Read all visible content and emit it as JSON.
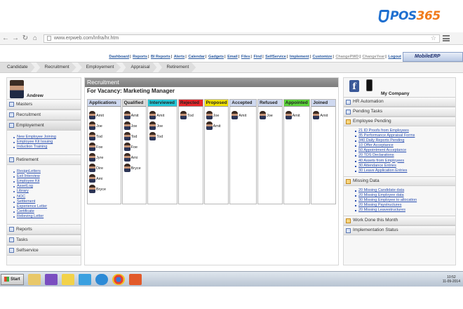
{
  "brand": {
    "prefix": "POS",
    "number": "365"
  },
  "browser": {
    "url": "www.erpweb.com/Infra/hr.htm",
    "back_icon": "back-arrow-icon",
    "forward_icon": "forward-arrow-icon",
    "reload_icon": "reload-icon",
    "home_icon": "home-icon"
  },
  "top_menu": {
    "items": [
      "Dashboard",
      "Reports",
      "BI Reports",
      "Alerts",
      "Calendar",
      "Gadgets",
      "Email",
      "Files",
      "Find",
      "SelfService",
      "Implement",
      "Customize"
    ],
    "dim_items": [
      "ChangePWD",
      "ChangeYear"
    ],
    "logout": "Logout",
    "mobile_erp": "MobileERP"
  },
  "tabs": [
    "Candidate",
    "Recruitment",
    "Employement",
    "Appraisal",
    "Retirement"
  ],
  "user": {
    "name": "Andrew"
  },
  "left_sections": {
    "masters": "Masters",
    "recruitment": "Recruitment",
    "employement": "Employement",
    "employement_links": [
      "New Employee Joining",
      "Employee Kit Issuing",
      "Induction Training"
    ],
    "retirement": "Retirement",
    "retirement_links": [
      "ResignLetters",
      "Exit Interview",
      "Employee Kit",
      "AssetLog",
      "Library",
      "NOC",
      "Settlement",
      "Experience Letter",
      "Certificate",
      "Relieving Letter"
    ],
    "reports": "Reports",
    "tasks": "Tasks",
    "selfservice": "Selfservice"
  },
  "main": {
    "header": "Recruitment",
    "vacancy": "For Vacancy: Marketing Manager",
    "columns": [
      {
        "title": "Applications",
        "color": "#cfd9f0",
        "people": [
          "Amit",
          "Joe",
          "Tod",
          "Foe",
          "Jyre",
          "Dire",
          "Ami",
          "Bryce"
        ]
      },
      {
        "title": "Qualified",
        "color": "#dadada",
        "people": [
          "Amit",
          "Joe",
          "Tod",
          "Foe",
          "Ami",
          "Bryce"
        ]
      },
      {
        "title": "Interviewed",
        "color": "#24c8d8",
        "people": [
          "Amit",
          "Joe",
          "Tod"
        ]
      },
      {
        "title": "Rejected",
        "color": "#e8262a",
        "people": [
          "Tod"
        ]
      },
      {
        "title": "Proposed",
        "color": "#f2e200",
        "people": [
          "Joe",
          "Amit"
        ]
      },
      {
        "title": "Accepted",
        "color": "#cfd9f0",
        "people": [
          "Amit"
        ]
      },
      {
        "title": "Refused",
        "color": "#cfd9f0",
        "people": [
          "Joe"
        ]
      },
      {
        "title": "Appointed",
        "color": "#5cd43a",
        "people": [
          "Amit"
        ]
      },
      {
        "title": "Joined",
        "color": "#cfd9f0",
        "people": [
          "Amit"
        ]
      }
    ]
  },
  "right_panel": {
    "company": "My Company",
    "hr_automation": "HR Automation",
    "pending_tasks": "Pending Tasks",
    "employee_pending": "Employee Pending",
    "employee_pending_links": [
      "21 ID Proofs from Employees",
      "35 Performance Appraisal Forms",
      "340 Daily Reports Pending",
      "10 Offer Acceptance",
      "50 Appointment Acceptance",
      "20 TDS Declarations",
      "40 Assets from Employees",
      "30 Attendance Entries",
      "30 Leave Application Entries"
    ],
    "missing_data": "Missing Data",
    "missing_data_links": [
      "20 Missing Candidate data",
      "20 Missing Employee data",
      "30 Missing Employee to allocation",
      "20 Missing Paystructures",
      "20 Missing Leavestructures"
    ],
    "work_done": "Work Done this Month",
    "implementation": "Implementation Status"
  },
  "taskbar": {
    "start": "Start",
    "time": "10:52",
    "date": "11-09-2014"
  }
}
